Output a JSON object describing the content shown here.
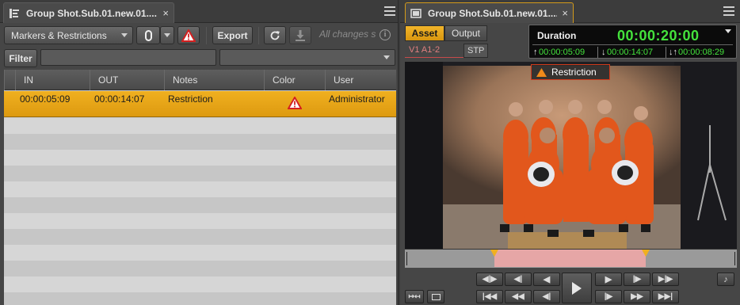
{
  "left": {
    "tab": {
      "title": "Group Shot.Sub.01.new.01....",
      "close": "×"
    },
    "toolbar": {
      "view_dropdown": "Markers & Restrictions",
      "export_label": "Export",
      "status_text": "All changes s"
    },
    "filter": {
      "label": "Filter",
      "text_value": "",
      "combo_value": ""
    },
    "table": {
      "columns": [
        "IN",
        "OUT",
        "Notes",
        "Color",
        "User"
      ],
      "rows": [
        {
          "in": "00:00:05:09",
          "out": "00:00:14:07",
          "notes": "Restriction",
          "color_icon": "warning-triangle-icon",
          "user": "Administrator",
          "selected": true
        }
      ]
    }
  },
  "right": {
    "tab": {
      "title": "Group Shot.Sub.01.new.01....",
      "close": "×"
    },
    "modes": {
      "asset": "Asset",
      "output": "Output",
      "active": "asset"
    },
    "tracks": {
      "label": "V1 A1-2",
      "stp": "STP"
    },
    "timecode": {
      "label": "Duration",
      "main": "00:00:20:00",
      "mark_in": "00:00:05:09",
      "mark_out": "00:00:14:07",
      "remaining": "00:00:08:29"
    },
    "overlay_label": "Restriction",
    "timeline": {
      "restriction_start_fraction": 0.27,
      "restriction_end_fraction": 0.725
    }
  },
  "colors": {
    "accent": "#e3a21a",
    "selection_row": "#e8a615",
    "timecode_green": "#44e23c",
    "restriction_red": "#d42020",
    "restriction_band": "#e6a6a6"
  }
}
